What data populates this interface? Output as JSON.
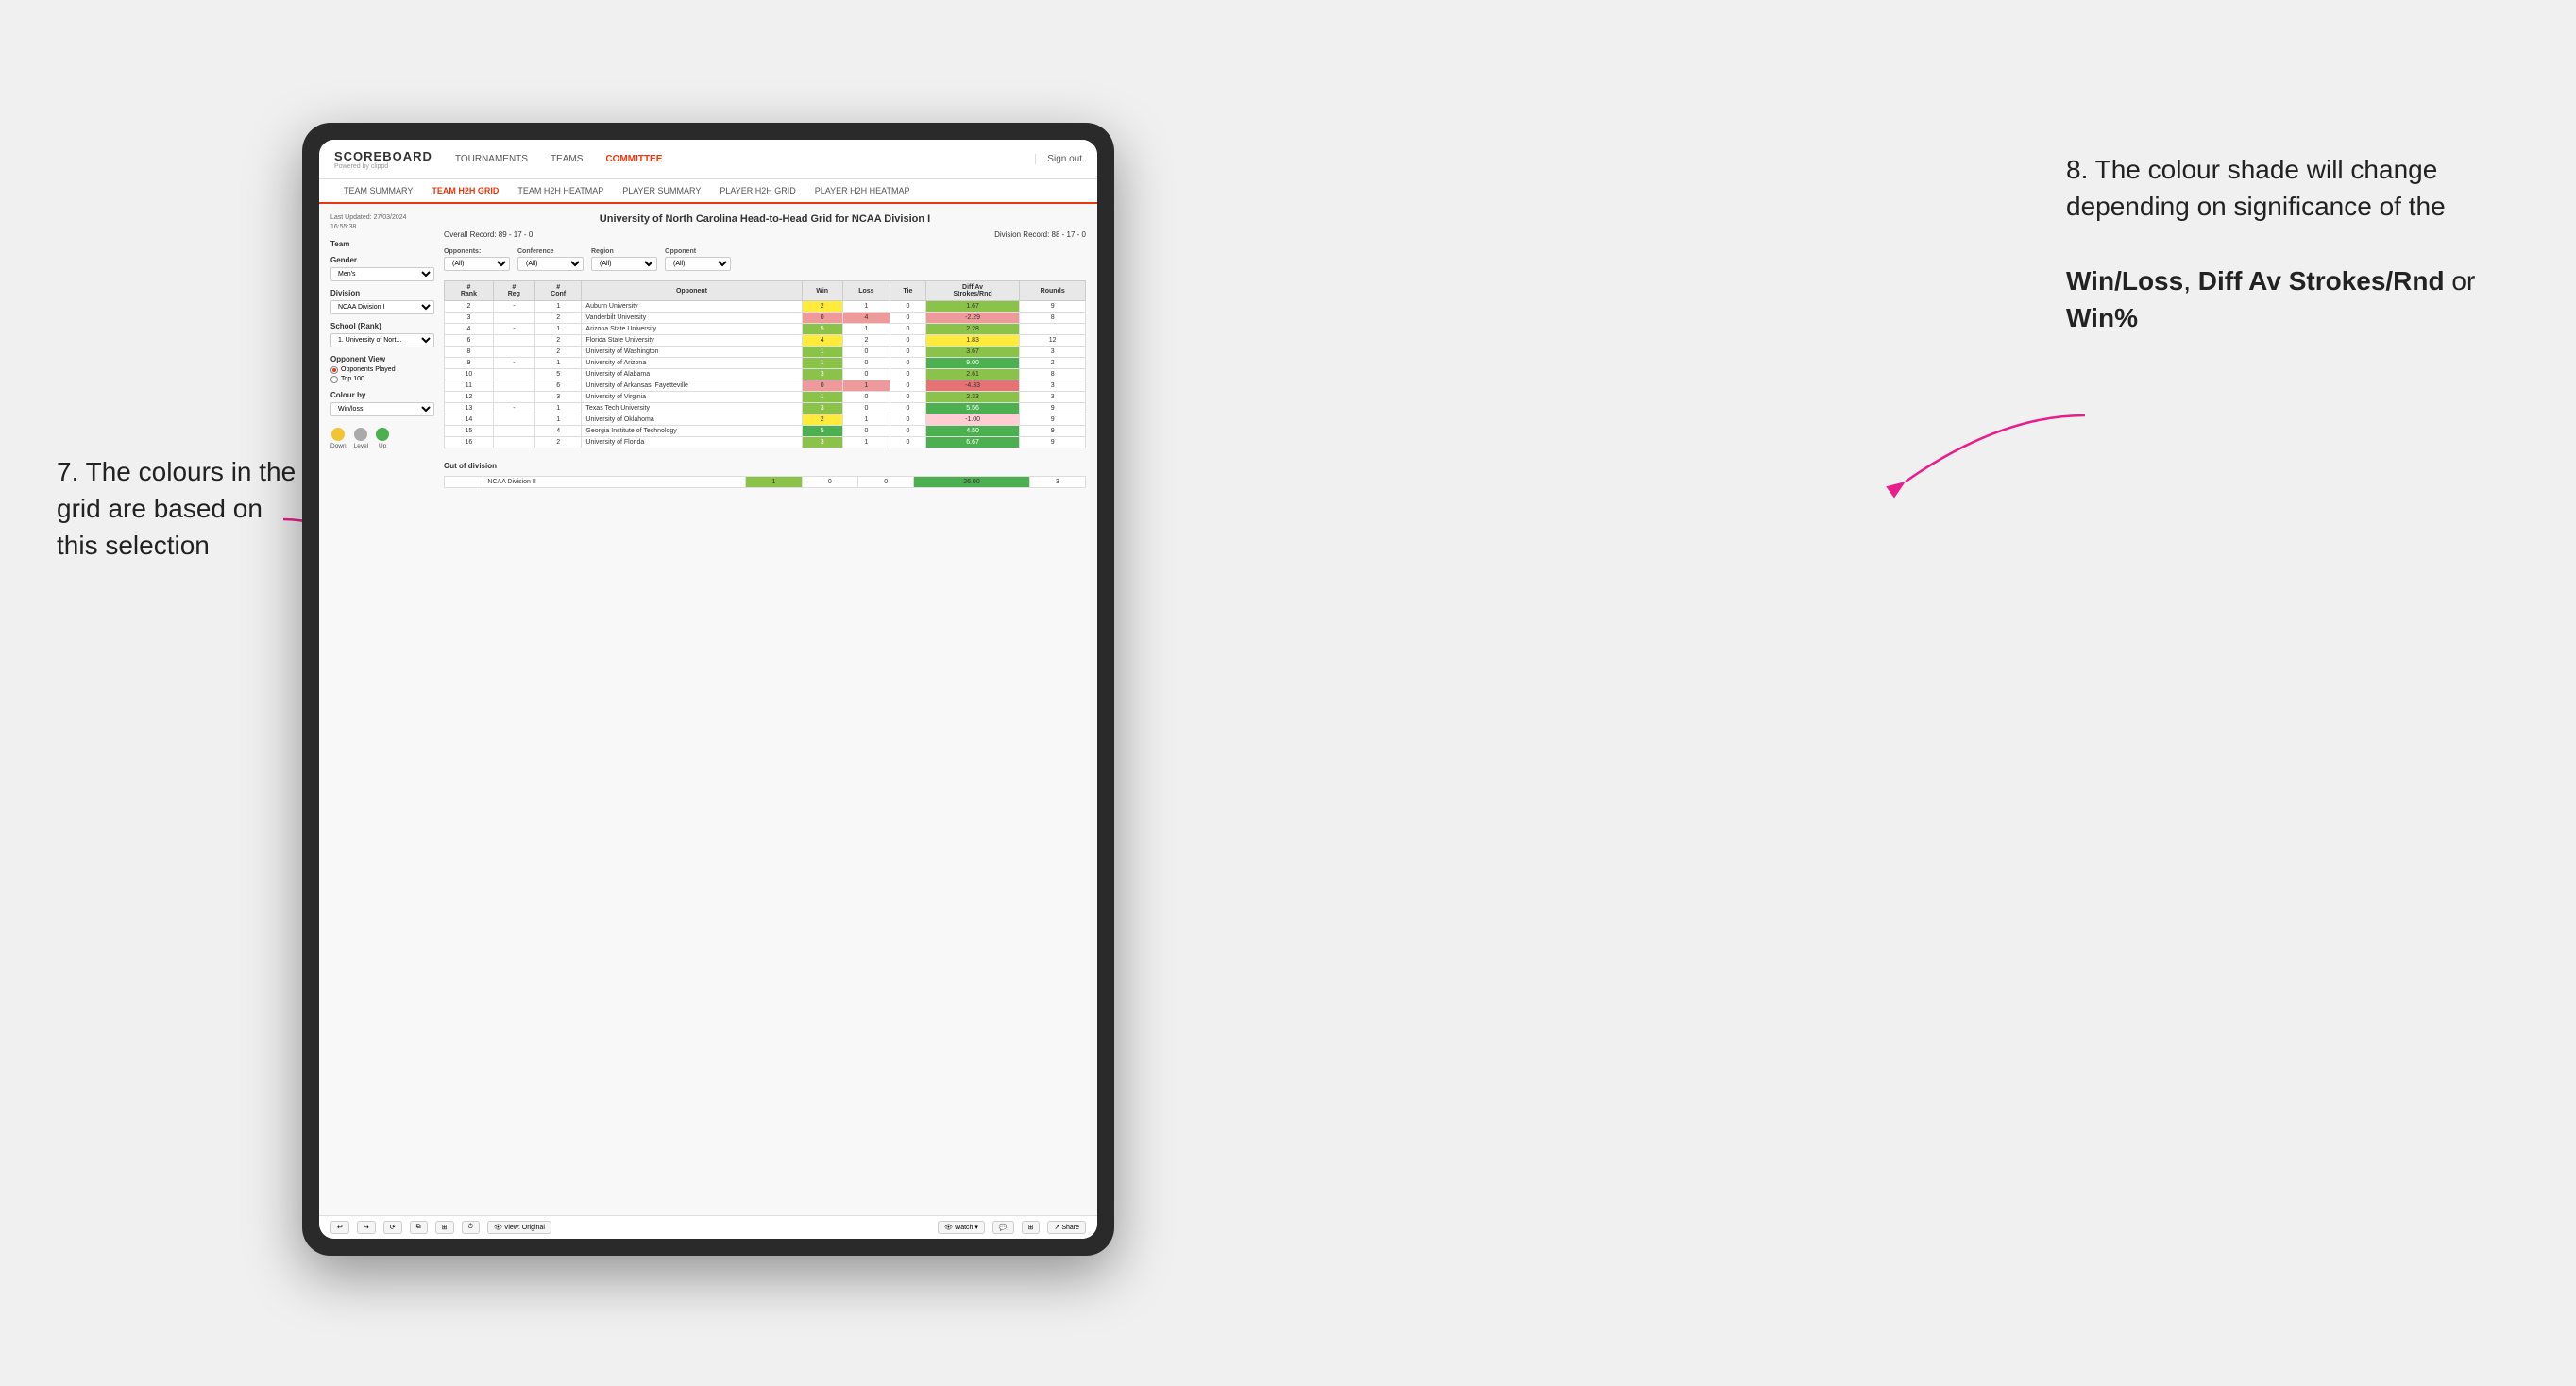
{
  "annotations": {
    "left_title": "7. The colours in the grid are based on this selection",
    "right_title": "8. The colour shade will change depending on significance of the",
    "right_bold1": "Win/Loss",
    "right_bold2": "Diff Av Strokes/Rnd",
    "right_bold3": "Win%",
    "right_connector": " or "
  },
  "header": {
    "logo": "SCOREBOARD",
    "logo_sub": "Powered by clippd",
    "nav_items": [
      "TOURNAMENTS",
      "TEAMS",
      "COMMITTEE"
    ],
    "sign_out": "Sign out"
  },
  "sub_nav": {
    "items": [
      "TEAM SUMMARY",
      "TEAM H2H GRID",
      "TEAM H2H HEATMAP",
      "PLAYER SUMMARY",
      "PLAYER H2H GRID",
      "PLAYER H2H HEATMAP"
    ],
    "active": "TEAM H2H GRID"
  },
  "left_panel": {
    "last_updated_label": "Last Updated: 27/03/2024",
    "last_updated_time": "16:55:38",
    "team_label": "Team",
    "gender_label": "Gender",
    "gender_value": "Men's",
    "division_label": "Division",
    "division_value": "NCAA Division I",
    "school_label": "School (Rank)",
    "school_value": "1. University of Nort...",
    "opponent_view_label": "Opponent View",
    "radio1": "Opponents Played",
    "radio2": "Top 100",
    "colour_by_label": "Colour by",
    "colour_by_value": "Win/loss",
    "legend": {
      "down_label": "Down",
      "level_label": "Level",
      "up_label": "Up",
      "down_color": "#f4c430",
      "level_color": "#aaa",
      "up_color": "#4caf50"
    }
  },
  "grid": {
    "title": "University of North Carolina Head-to-Head Grid for NCAA Division I",
    "overall_record": "Overall Record: 89 - 17 - 0",
    "division_record": "Division Record: 88 - 17 - 0",
    "filters": {
      "opponents_label": "Opponents:",
      "opponents_value": "(All)",
      "conference_label": "Conference",
      "conference_value": "(All)",
      "region_label": "Region",
      "region_value": "(All)",
      "opponent_label": "Opponent",
      "opponent_value": "(All)"
    },
    "columns": [
      "#\nRank",
      "#\nReg",
      "#\nConf",
      "Opponent",
      "Win",
      "Loss",
      "Tie",
      "Diff Av\nStrokes/Rnd",
      "Rounds"
    ],
    "rows": [
      {
        "rank": "2",
        "reg": "-",
        "conf": "1",
        "opponent": "Auburn University",
        "win": "2",
        "loss": "1",
        "tie": "0",
        "diff": "1.67",
        "rounds": "9",
        "win_color": "yellow",
        "diff_color": "green"
      },
      {
        "rank": "3",
        "reg": "",
        "conf": "2",
        "opponent": "Vanderbilt University",
        "win": "0",
        "loss": "4",
        "tie": "0",
        "diff": "-2.29",
        "rounds": "8",
        "win_color": "red",
        "diff_color": "red"
      },
      {
        "rank": "4",
        "reg": "-",
        "conf": "1",
        "opponent": "Arizona State University",
        "win": "5",
        "loss": "1",
        "tie": "0",
        "diff": "2.28",
        "rounds": "",
        "win_color": "green",
        "diff_color": "green"
      },
      {
        "rank": "6",
        "reg": "",
        "conf": "2",
        "opponent": "Florida State University",
        "win": "4",
        "loss": "2",
        "tie": "0",
        "diff": "1.83",
        "rounds": "12",
        "win_color": "yellow",
        "diff_color": "yellow"
      },
      {
        "rank": "8",
        "reg": "",
        "conf": "2",
        "opponent": "University of Washington",
        "win": "1",
        "loss": "0",
        "tie": "0",
        "diff": "3.67",
        "rounds": "3",
        "win_color": "green",
        "diff_color": "green"
      },
      {
        "rank": "9",
        "reg": "-",
        "conf": "1",
        "opponent": "University of Arizona",
        "win": "1",
        "loss": "0",
        "tie": "0",
        "diff": "9.00",
        "rounds": "2",
        "win_color": "green",
        "diff_color": "green-dark"
      },
      {
        "rank": "10",
        "reg": "",
        "conf": "5",
        "opponent": "University of Alabama",
        "win": "3",
        "loss": "0",
        "tie": "0",
        "diff": "2.61",
        "rounds": "8",
        "win_color": "green",
        "diff_color": "green",
        "highlight": true
      },
      {
        "rank": "11",
        "reg": "",
        "conf": "6",
        "opponent": "University of Arkansas, Fayetteville",
        "win": "0",
        "loss": "1",
        "tie": "0",
        "diff": "-4.33",
        "rounds": "3",
        "win_color": "red",
        "diff_color": "red-dark"
      },
      {
        "rank": "12",
        "reg": "",
        "conf": "3",
        "opponent": "University of Virginia",
        "win": "1",
        "loss": "0",
        "tie": "0",
        "diff": "2.33",
        "rounds": "3",
        "win_color": "green",
        "diff_color": "green"
      },
      {
        "rank": "13",
        "reg": "-",
        "conf": "1",
        "opponent": "Texas Tech University",
        "win": "3",
        "loss": "0",
        "tie": "0",
        "diff": "5.56",
        "rounds": "9",
        "win_color": "green",
        "diff_color": "green-dark"
      },
      {
        "rank": "14",
        "reg": "",
        "conf": "1",
        "opponent": "University of Oklahoma",
        "win": "2",
        "loss": "1",
        "tie": "0",
        "diff": "-1.00",
        "rounds": "9",
        "win_color": "yellow",
        "diff_color": "red-light"
      },
      {
        "rank": "15",
        "reg": "",
        "conf": "4",
        "opponent": "Georgia Institute of Technology",
        "win": "5",
        "loss": "0",
        "tie": "0",
        "diff": "4.50",
        "rounds": "9",
        "win_color": "green-dark",
        "diff_color": "green-dark"
      },
      {
        "rank": "16",
        "reg": "",
        "conf": "2",
        "opponent": "University of Florida",
        "win": "3",
        "loss": "1",
        "tie": "0",
        "diff": "6.67",
        "rounds": "9",
        "win_color": "green",
        "diff_color": "green-dark"
      }
    ],
    "out_of_division_label": "Out of division",
    "out_of_division_row": {
      "division": "NCAA Division II",
      "win": "1",
      "loss": "0",
      "tie": "0",
      "diff": "26.00",
      "rounds": "3",
      "win_color": "green",
      "diff_color": "green-dark"
    }
  },
  "toolbar": {
    "view_label": "View: Original",
    "watch_label": "Watch",
    "share_label": "Share"
  }
}
